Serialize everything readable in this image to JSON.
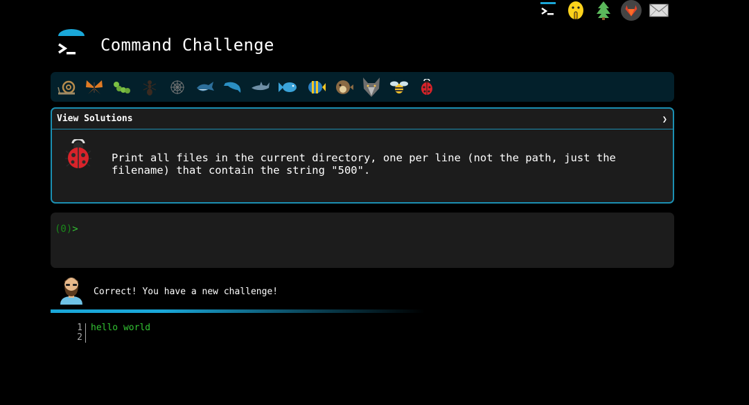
{
  "header": {
    "title": "Command Challenge"
  },
  "top_icons": [
    {
      "name": "terminal-icon"
    },
    {
      "name": "shushing-face-icon"
    },
    {
      "name": "tree-icon"
    },
    {
      "name": "gitlab-icon"
    },
    {
      "name": "mail-icon"
    }
  ],
  "levels": [
    "snail-icon",
    "butterfly-icon",
    "caterpillar-icon",
    "ant-icon",
    "spider-web-icon",
    "whale-icon",
    "dolphin-icon",
    "dolphin-gray-icon",
    "fish-icon",
    "tropical-fish-icon",
    "blowfish-icon",
    "wolf-icon",
    "bee-icon",
    "ladybug-icon"
  ],
  "panel": {
    "head_label": "View Solutions",
    "chevron": "❯",
    "icon": "ladybug-icon",
    "text": "Print all files in the current directory, one per line (not the path, just the filename) that contain the string \"500\"."
  },
  "terminal": {
    "prompt": "(0)>",
    "value": ""
  },
  "result": {
    "avatar": "bearded-man-icon",
    "message": "Correct! You have a new challenge!"
  },
  "output": {
    "line_numbers": [
      "1",
      "2"
    ],
    "lines": [
      "hello world",
      ""
    ]
  },
  "colors": {
    "accent": "#1b90b3",
    "prompt_green": "#33c433",
    "panel_bg": "#1c1c1c",
    "levels_bg": "#03202b"
  }
}
